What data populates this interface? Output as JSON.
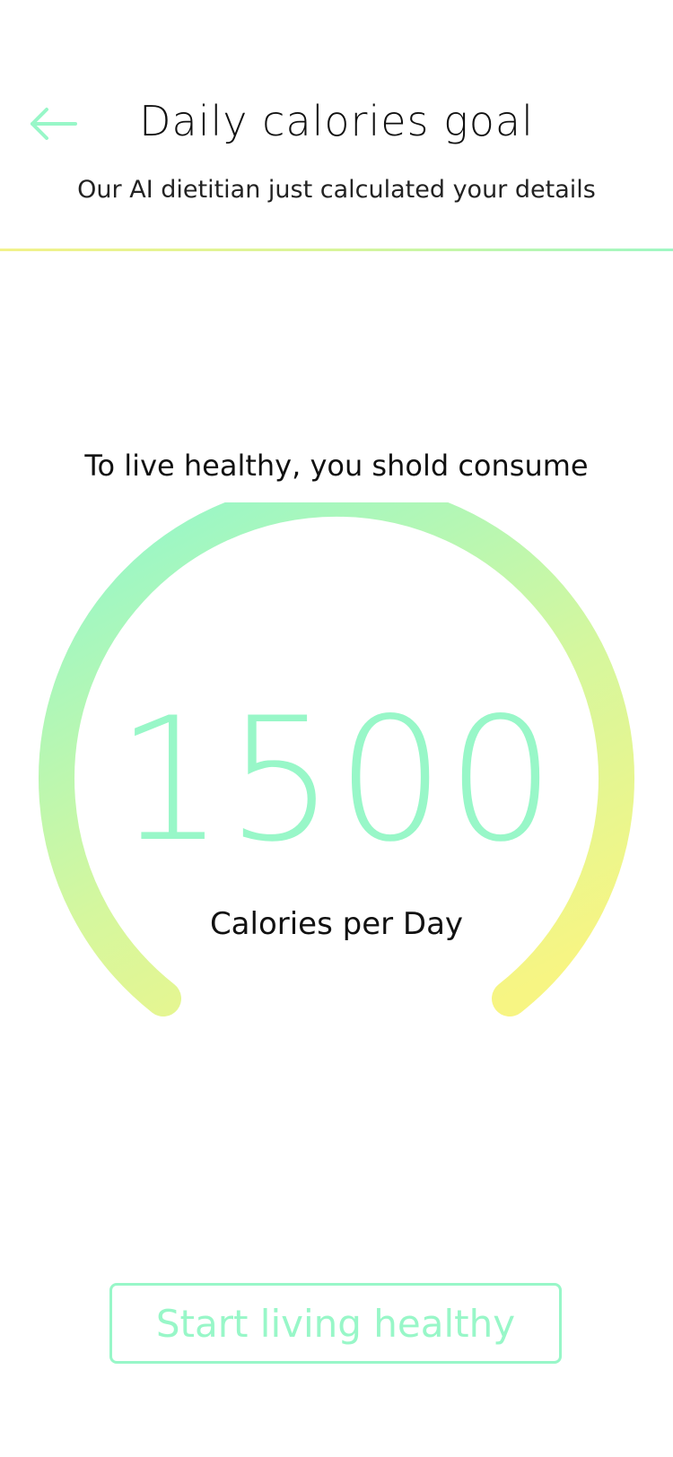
{
  "header": {
    "back_icon": "arrow-left-icon",
    "title": "Daily calories goal",
    "subtitle": "Our AI dietitian just calculated your details"
  },
  "main": {
    "intro": "To live healthy, you shold consume",
    "calories": "1500",
    "unit": "Calories per Day",
    "gauge_fill_fraction": 1.0
  },
  "cta": {
    "label": "Start living healthy"
  },
  "colors": {
    "accent_green": "#98f7c8",
    "accent_yellow": "#f5f585",
    "text": "#111111",
    "background": "#ffffff"
  }
}
